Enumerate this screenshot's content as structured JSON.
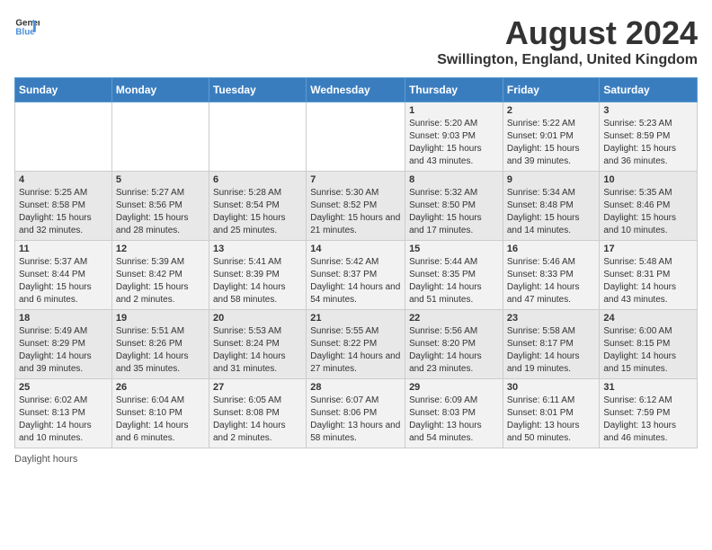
{
  "header": {
    "logo_general": "General",
    "logo_blue": "Blue",
    "month_year": "August 2024",
    "location": "Swillington, England, United Kingdom"
  },
  "days_of_week": [
    "Sunday",
    "Monday",
    "Tuesday",
    "Wednesday",
    "Thursday",
    "Friday",
    "Saturday"
  ],
  "weeks": [
    [
      {
        "day": "",
        "info": ""
      },
      {
        "day": "",
        "info": ""
      },
      {
        "day": "",
        "info": ""
      },
      {
        "day": "",
        "info": ""
      },
      {
        "day": "1",
        "info": "Sunrise: 5:20 AM\nSunset: 9:03 PM\nDaylight: 15 hours and 43 minutes."
      },
      {
        "day": "2",
        "info": "Sunrise: 5:22 AM\nSunset: 9:01 PM\nDaylight: 15 hours and 39 minutes."
      },
      {
        "day": "3",
        "info": "Sunrise: 5:23 AM\nSunset: 8:59 PM\nDaylight: 15 hours and 36 minutes."
      }
    ],
    [
      {
        "day": "4",
        "info": "Sunrise: 5:25 AM\nSunset: 8:58 PM\nDaylight: 15 hours and 32 minutes."
      },
      {
        "day": "5",
        "info": "Sunrise: 5:27 AM\nSunset: 8:56 PM\nDaylight: 15 hours and 28 minutes."
      },
      {
        "day": "6",
        "info": "Sunrise: 5:28 AM\nSunset: 8:54 PM\nDaylight: 15 hours and 25 minutes."
      },
      {
        "day": "7",
        "info": "Sunrise: 5:30 AM\nSunset: 8:52 PM\nDaylight: 15 hours and 21 minutes."
      },
      {
        "day": "8",
        "info": "Sunrise: 5:32 AM\nSunset: 8:50 PM\nDaylight: 15 hours and 17 minutes."
      },
      {
        "day": "9",
        "info": "Sunrise: 5:34 AM\nSunset: 8:48 PM\nDaylight: 15 hours and 14 minutes."
      },
      {
        "day": "10",
        "info": "Sunrise: 5:35 AM\nSunset: 8:46 PM\nDaylight: 15 hours and 10 minutes."
      }
    ],
    [
      {
        "day": "11",
        "info": "Sunrise: 5:37 AM\nSunset: 8:44 PM\nDaylight: 15 hours and 6 minutes."
      },
      {
        "day": "12",
        "info": "Sunrise: 5:39 AM\nSunset: 8:42 PM\nDaylight: 15 hours and 2 minutes."
      },
      {
        "day": "13",
        "info": "Sunrise: 5:41 AM\nSunset: 8:39 PM\nDaylight: 14 hours and 58 minutes."
      },
      {
        "day": "14",
        "info": "Sunrise: 5:42 AM\nSunset: 8:37 PM\nDaylight: 14 hours and 54 minutes."
      },
      {
        "day": "15",
        "info": "Sunrise: 5:44 AM\nSunset: 8:35 PM\nDaylight: 14 hours and 51 minutes."
      },
      {
        "day": "16",
        "info": "Sunrise: 5:46 AM\nSunset: 8:33 PM\nDaylight: 14 hours and 47 minutes."
      },
      {
        "day": "17",
        "info": "Sunrise: 5:48 AM\nSunset: 8:31 PM\nDaylight: 14 hours and 43 minutes."
      }
    ],
    [
      {
        "day": "18",
        "info": "Sunrise: 5:49 AM\nSunset: 8:29 PM\nDaylight: 14 hours and 39 minutes."
      },
      {
        "day": "19",
        "info": "Sunrise: 5:51 AM\nSunset: 8:26 PM\nDaylight: 14 hours and 35 minutes."
      },
      {
        "day": "20",
        "info": "Sunrise: 5:53 AM\nSunset: 8:24 PM\nDaylight: 14 hours and 31 minutes."
      },
      {
        "day": "21",
        "info": "Sunrise: 5:55 AM\nSunset: 8:22 PM\nDaylight: 14 hours and 27 minutes."
      },
      {
        "day": "22",
        "info": "Sunrise: 5:56 AM\nSunset: 8:20 PM\nDaylight: 14 hours and 23 minutes."
      },
      {
        "day": "23",
        "info": "Sunrise: 5:58 AM\nSunset: 8:17 PM\nDaylight: 14 hours and 19 minutes."
      },
      {
        "day": "24",
        "info": "Sunrise: 6:00 AM\nSunset: 8:15 PM\nDaylight: 14 hours and 15 minutes."
      }
    ],
    [
      {
        "day": "25",
        "info": "Sunrise: 6:02 AM\nSunset: 8:13 PM\nDaylight: 14 hours and 10 minutes."
      },
      {
        "day": "26",
        "info": "Sunrise: 6:04 AM\nSunset: 8:10 PM\nDaylight: 14 hours and 6 minutes."
      },
      {
        "day": "27",
        "info": "Sunrise: 6:05 AM\nSunset: 8:08 PM\nDaylight: 14 hours and 2 minutes."
      },
      {
        "day": "28",
        "info": "Sunrise: 6:07 AM\nSunset: 8:06 PM\nDaylight: 13 hours and 58 minutes."
      },
      {
        "day": "29",
        "info": "Sunrise: 6:09 AM\nSunset: 8:03 PM\nDaylight: 13 hours and 54 minutes."
      },
      {
        "day": "30",
        "info": "Sunrise: 6:11 AM\nSunset: 8:01 PM\nDaylight: 13 hours and 50 minutes."
      },
      {
        "day": "31",
        "info": "Sunrise: 6:12 AM\nSunset: 7:59 PM\nDaylight: 13 hours and 46 minutes."
      }
    ]
  ],
  "footer": {
    "daylight_label": "Daylight hours"
  }
}
